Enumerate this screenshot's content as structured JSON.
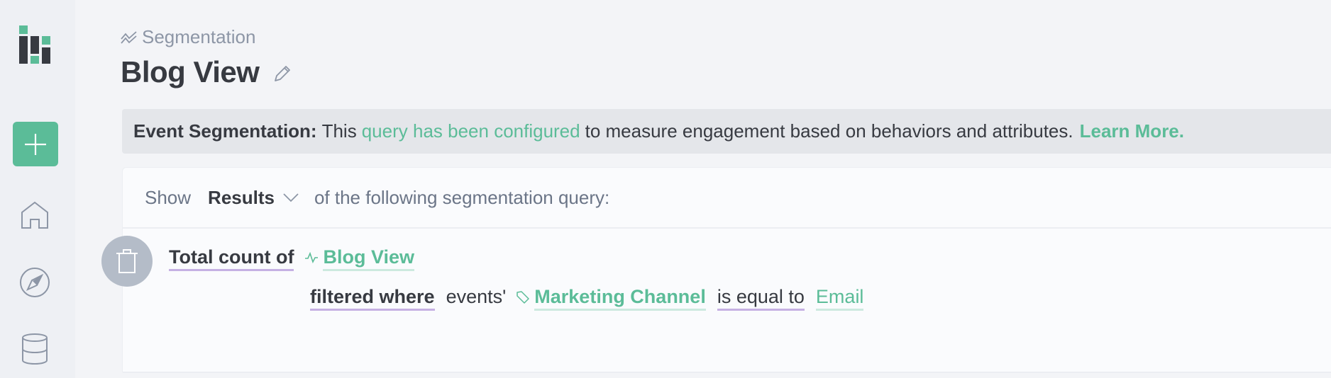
{
  "sidebar": {
    "logo": "analytics-logo",
    "add_button": "plus-icon",
    "nav": [
      {
        "icon": "home-icon"
      },
      {
        "icon": "compass-icon"
      },
      {
        "icon": "database-icon"
      }
    ]
  },
  "breadcrumb": {
    "icon": "segmentation-chart-icon",
    "label": "Segmentation"
  },
  "page": {
    "title": "Blog View",
    "edit_icon": "pencil-icon"
  },
  "banner": {
    "label": "Event Segmentation:",
    "text_before": "This",
    "link": "query has been configured",
    "text_after": "to measure engagement based on behaviors and attributes.",
    "learn_more": "Learn More."
  },
  "query_card": {
    "show_label": "Show",
    "mode": "Results",
    "suffix": "of the following segmentation query:",
    "delete_icon": "trash-icon",
    "clause": {
      "aggregation": "Total count of",
      "event_icon": "activity-pulse-icon",
      "event": "Blog View",
      "filter_label": "filtered where",
      "scope": "events'",
      "property_icon": "tag-icon",
      "property": "Marketing Channel",
      "operator": "is equal to",
      "value": "Email"
    }
  },
  "colors": {
    "accent": "#5bbc98",
    "keyword_underline": "#c5b0e3",
    "text": "#373a41",
    "muted": "#8d96a6"
  }
}
